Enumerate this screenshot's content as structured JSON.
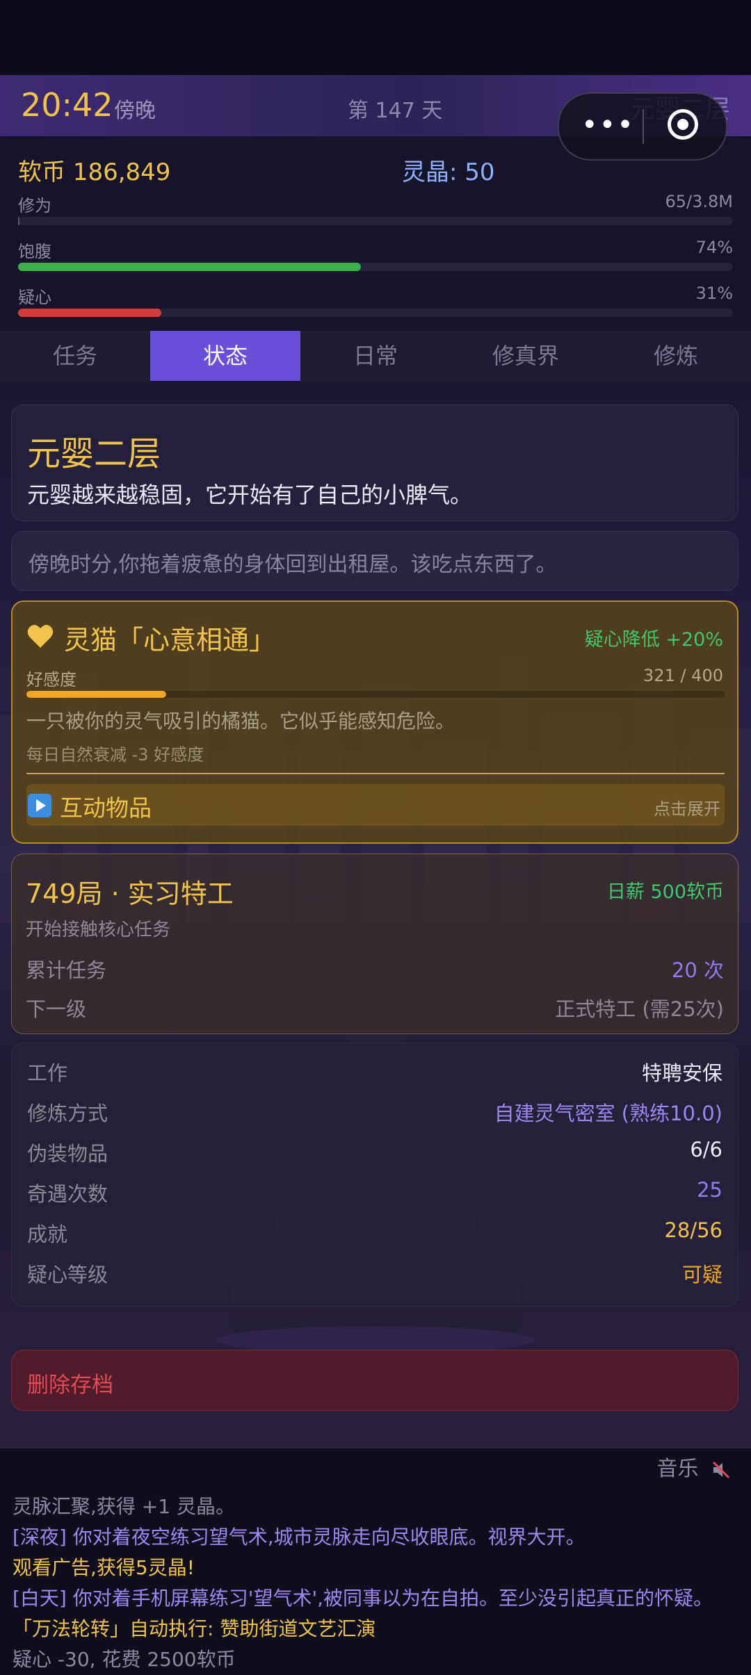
{
  "header": {
    "time": "20:42",
    "period": "傍晚",
    "day": "第 147 天",
    "realm_short": "元婴二层"
  },
  "capsule": {
    "more_glyph": "•••"
  },
  "stats": {
    "coins": "软币 186,849",
    "crystals": "灵晶: 50",
    "bars": [
      {
        "label": "修为",
        "value": "65/3.8M",
        "fraction": 0.0,
        "color": "#5a5870"
      },
      {
        "label": "饱腹",
        "value": "74%",
        "fraction": 0.48,
        "color": "#3bb24f"
      },
      {
        "label": "疑心",
        "value": "31%",
        "fraction": 0.2,
        "color": "#d43b3b"
      }
    ]
  },
  "tabs": [
    {
      "label": "任务",
      "active": false
    },
    {
      "label": "状态",
      "active": true
    },
    {
      "label": "日常",
      "active": false
    },
    {
      "label": "修真界",
      "active": false
    },
    {
      "label": "修炼",
      "active": false
    }
  ],
  "realm": {
    "title": "元婴二层",
    "desc": "元婴越来越稳固，它开始有了自己的小脾气。"
  },
  "message": "傍晚时分,你拖着疲惫的身体回到出租屋。该吃点东西了。",
  "pet": {
    "name": "灵猫「心意相通」",
    "bonus": "疑心降低 +20%",
    "affection_label": "好感度",
    "affection_value": "321 / 400",
    "affection_fraction": 0.2,
    "desc": "一只被你的灵气吸引的橘猫。它似乎能感知危险。",
    "decay": "每日自然衰减 -3 好感度",
    "items_label": "互动物品",
    "items_hint": "点击展开",
    "heart_color": "#f2c34a"
  },
  "job": {
    "title": "749局 · 实习特工",
    "salary": "日薪 500软币",
    "sub": "开始接触核心任务",
    "rows": [
      {
        "label": "累计任务",
        "value": "20 次",
        "color": "#8f7df0"
      },
      {
        "label": "下一级",
        "value": "正式特工 (需25次)",
        "color": "#8e8796"
      }
    ]
  },
  "info": [
    {
      "label": "工作",
      "value": "特聘安保",
      "color": "#ece9f5"
    },
    {
      "label": "修炼方式",
      "value": "自建灵气密室 (熟练10.0)",
      "color": "#9f86f2"
    },
    {
      "label": "伪装物品",
      "value": "6/6",
      "color": "#ece9f5"
    },
    {
      "label": "奇遇次数",
      "value": "25",
      "color": "#8f7df0"
    },
    {
      "label": "成就",
      "value": "28/56",
      "color": "#f2c34a"
    },
    {
      "label": "疑心等级",
      "value": "可疑",
      "color": "#f2a623"
    }
  ],
  "delete_label": "删除存档",
  "music_label": "音乐",
  "log": [
    {
      "text": "灵脉汇聚,获得 +1 灵晶。",
      "color": "#8e88a6"
    },
    {
      "text": "[深夜] 你对着夜空练习望气术,城市灵脉走向尽收眼底。视界大开。",
      "color": "#9f86f2"
    },
    {
      "text": "观看广告,获得5灵晶!",
      "color": "#f2c34a"
    },
    {
      "text": "[白天] 你对着手机屏幕练习'望气术',被同事以为在自拍。至少没引起真正的怀疑。",
      "color": "#9f86f2"
    },
    {
      "text": "「万法轮转」自动执行: 赞助街道文艺汇演",
      "color": "#f2c34a"
    },
    {
      "text": "疑心 -30, 花费 2500软币",
      "color": "#8e88a6"
    }
  ]
}
